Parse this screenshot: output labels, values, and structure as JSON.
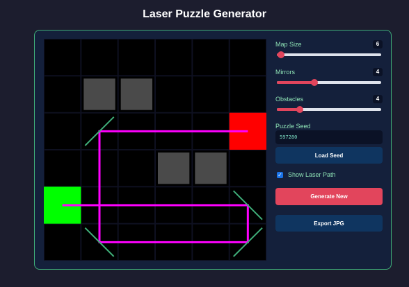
{
  "title": "Laser Puzzle Generator",
  "controls": {
    "map_size": {
      "label": "Map Size",
      "value": "6",
      "fraction": 0.04
    },
    "mirrors": {
      "label": "Mirrors",
      "value": "4",
      "fraction": 0.36
    },
    "obstacles": {
      "label": "Obstacles",
      "value": "4",
      "fraction": 0.22
    },
    "seed_label": "Puzzle Seed",
    "seed_value": "597280",
    "load_seed_label": "Load Seed",
    "show_laser_label": "Show Laser Path",
    "show_laser_checked": true,
    "generate_label": "Generate New",
    "export_label": "Export JPG"
  },
  "grid": {
    "size": 6,
    "source": {
      "row": 4,
      "col": 0,
      "color": "#00ff00"
    },
    "target": {
      "row": 2,
      "col": 5,
      "color": "#ff0000"
    },
    "obstacles": [
      {
        "row": 1,
        "col": 1
      },
      {
        "row": 1,
        "col": 2
      },
      {
        "row": 3,
        "col": 3
      },
      {
        "row": 3,
        "col": 4
      }
    ],
    "mirrors": [
      {
        "row": 2,
        "col": 1,
        "orientation": "/"
      },
      {
        "row": 4,
        "col": 5,
        "orientation": "\\"
      },
      {
        "row": 5,
        "col": 5,
        "orientation": "/"
      },
      {
        "row": 5,
        "col": 1,
        "orientation": "\\"
      }
    ],
    "laser_path": [
      [
        4,
        0
      ],
      [
        4,
        5
      ],
      [
        5,
        5
      ],
      [
        5,
        1
      ],
      [
        2,
        1
      ],
      [
        2,
        5
      ]
    ],
    "colors": {
      "cell": "#000000",
      "grid_line": "#14203b",
      "obstacle": "#4a4a4a",
      "mirror": "#3fae79",
      "laser": "#ff00ff"
    }
  }
}
